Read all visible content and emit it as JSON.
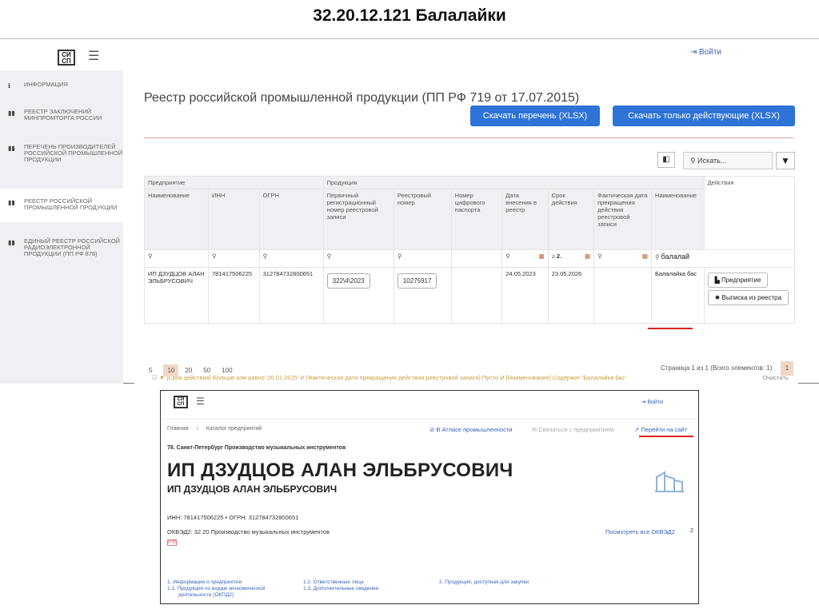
{
  "slide": {
    "title": "32.20.12.121 Балалайки"
  },
  "shot1": {
    "logo": "СИ СП",
    "login": "Войти",
    "sidebar": [
      {
        "label": "Информация",
        "icon": "info-icon",
        "glyph": "ℹ"
      },
      {
        "label": "Реестр заключений Минпромторга России",
        "icon": "book-icon",
        "glyph": "▮▮"
      },
      {
        "label": "Перечень производителей российской промышленной продукции",
        "icon": "book-icon",
        "glyph": "▮▮"
      },
      {
        "label": "Реестр российской промышленной продукции",
        "icon": "book-icon",
        "glyph": "▮▮"
      },
      {
        "label": "Единый реестр российской радиоэлектронной продукции (ПП РФ 878)",
        "icon": "book-icon",
        "glyph": "▮▮"
      }
    ],
    "registry_title": "Реестр российской промышленной продукции (ПП РФ 719 от 17.07.2015)",
    "download_all": "Скачать перечень (XLSX)",
    "download_active": "Скачать только действующие (XLSX)",
    "search_placeholder": "Искать...",
    "table": {
      "group_enterprise": "Предприятие",
      "group_product": "Продукция",
      "group_actions": "Действия",
      "columns": [
        "Наименование",
        "ИНН",
        "ОГРН",
        "Первичный регистрационный номер реестровой записи",
        "Реестровый номер",
        "Номер цифрового паспорта",
        "Дата внесения в реестр",
        "Срок действия",
        "Фактическая дата прекращения действия реестровой записи",
        "Наименование"
      ],
      "filter_term_op": "≥",
      "filter_term_val": "2.",
      "filter_name_val": "балалай",
      "row": {
        "name": "ИП ДЗУДЦОВ АЛАН ЭЛЬБРУСОВИЧ",
        "inn": "781417506225",
        "ogrn": "312784732800651",
        "primary_no": "322\\4\\2023",
        "registry_no": "10275917",
        "passport_no": "",
        "date_added": "24.05.2023",
        "term": "23.05.2026",
        "fact_end": "",
        "product_name": "Балалайка бас"
      },
      "btn_enterprise": "Предприятие",
      "btn_extract": "Выписка из реестра"
    },
    "filter_text": "[Срок действия] Больше или равно '20.01.2025' И [Фактическая дата прекращения действия реестровой записи] Пусто И [Наименование] Содержит 'Балалайка бас'",
    "clear": "Очистить",
    "pager": {
      "sizes": [
        "5",
        "10",
        "20",
        "50",
        "100"
      ],
      "current_size": "10",
      "info": "Страница 1 из 1 (Всего элементов: 1)",
      "page": "1"
    }
  },
  "shot2": {
    "logo": "СИ СП",
    "login": "Войти",
    "breadcrumb_home": "Главная",
    "breadcrumb_catalog": "Каталог предприятий",
    "link_atlas": "В Атласе промышленности",
    "link_contact": "Связаться с предприятием",
    "link_site": "Перейти на сайт",
    "city_line": "78. Санкт-Петербург  Производство музыкальных инструментов",
    "name_big": "ИП ДЗУДЦОВ АЛАН ЭЛЬБРУСОВИЧ",
    "name_small": "ИП ДЗУДЦОВ АЛАН ЭЛЬБРУСОВИЧ",
    "inn_line": "ИНН: 781417506225 • ОГРН: 312784732800651",
    "okved_line": "ОКВЭД2: 32.20 Производство музыкальных инструментов",
    "tag": "РПП",
    "all_okved": "Посмотреть все ОКВЭД2",
    "okved_count": "2",
    "footer": {
      "col1": [
        "1. Информация о предприятии",
        "1.1. Продукция по видам экономической",
        "деятельности (ОКПД2)"
      ],
      "col2": [
        "1.2. Ответственные лица",
        "1.3. Дополнительные сведения"
      ],
      "col3": [
        "2. Продукция, доступная для закупки"
      ]
    }
  }
}
